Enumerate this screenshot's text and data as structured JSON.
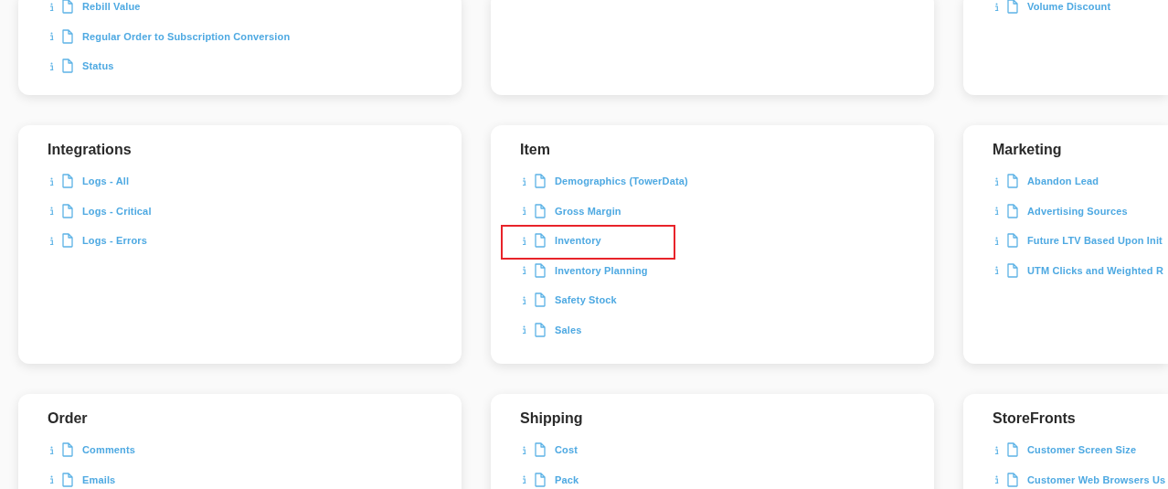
{
  "cards": [
    {
      "kind": "list",
      "items": [
        {
          "label": "Rebill Value",
          "highlighted": false
        },
        {
          "label": "Regular Order to Subscription Conversion",
          "highlighted": false
        },
        {
          "label": "Status",
          "highlighted": false
        }
      ]
    },
    {
      "kind": "blank"
    },
    {
      "kind": "list",
      "items": [
        {
          "label": "Volume Discount",
          "highlighted": false
        }
      ]
    },
    {
      "kind": "list",
      "title": "Integrations",
      "items": [
        {
          "label": "Logs - All",
          "highlighted": false
        },
        {
          "label": "Logs - Critical",
          "highlighted": false
        },
        {
          "label": "Logs - Errors",
          "highlighted": false
        }
      ]
    },
    {
      "kind": "list",
      "title": "Item",
      "items": [
        {
          "label": "Demographics (TowerData)",
          "highlighted": false
        },
        {
          "label": "Gross Margin",
          "highlighted": false
        },
        {
          "label": "Inventory",
          "highlighted": true
        },
        {
          "label": "Inventory Planning",
          "highlighted": false
        },
        {
          "label": "Safety Stock",
          "highlighted": false
        },
        {
          "label": "Sales",
          "highlighted": false
        }
      ]
    },
    {
      "kind": "list",
      "title": "Marketing",
      "items": [
        {
          "label": "Abandon Lead",
          "highlighted": false
        },
        {
          "label": "Advertising Sources",
          "highlighted": false
        },
        {
          "label": "Future LTV Based Upon Init",
          "highlighted": false
        },
        {
          "label": "UTM Clicks and Weighted R",
          "highlighted": false
        }
      ]
    },
    {
      "kind": "list",
      "title": "Order",
      "items": [
        {
          "label": "Comments",
          "highlighted": false
        },
        {
          "label": "Emails",
          "highlighted": false
        }
      ]
    },
    {
      "kind": "list",
      "title": "Shipping",
      "items": [
        {
          "label": "Cost",
          "highlighted": false
        },
        {
          "label": "Pack",
          "highlighted": false
        }
      ]
    },
    {
      "kind": "list",
      "title": "StoreFronts",
      "items": [
        {
          "label": "Customer Screen Size",
          "highlighted": false
        },
        {
          "label": "Customer Web Browsers Us",
          "highlighted": false
        }
      ]
    }
  ]
}
